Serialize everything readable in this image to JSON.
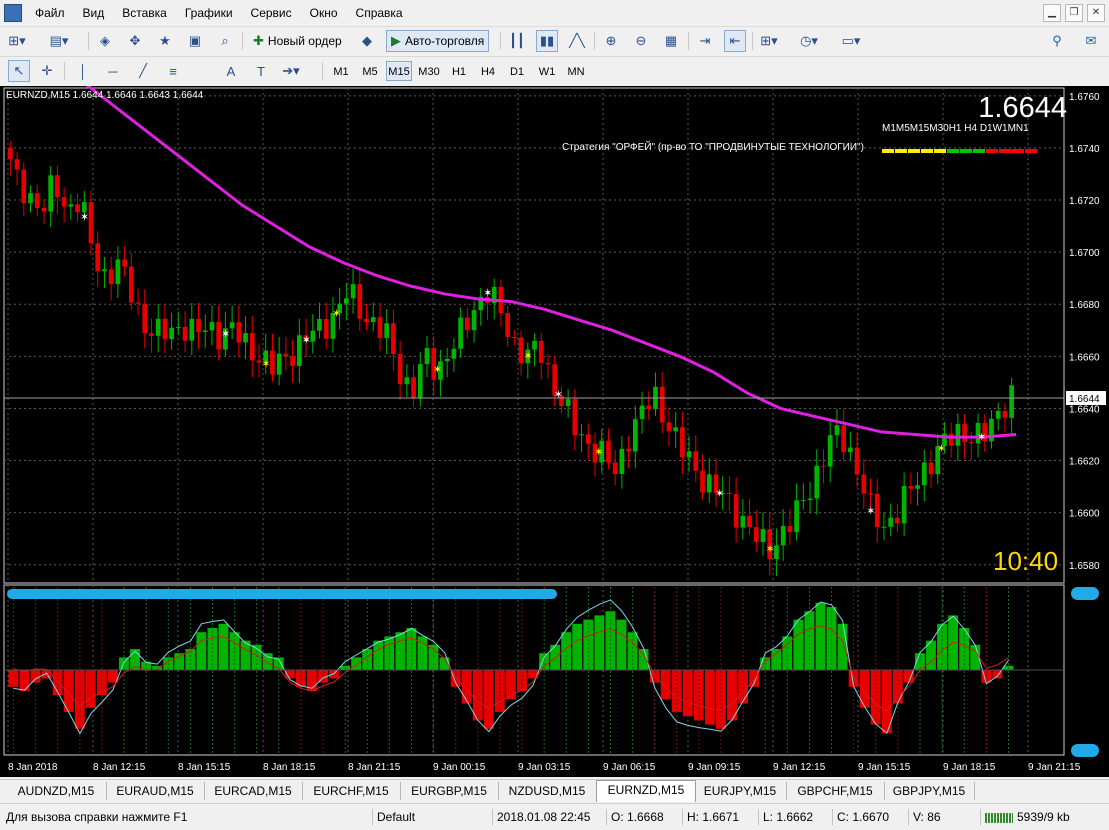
{
  "menu": {
    "items": [
      "Файл",
      "Вид",
      "Вставка",
      "Графики",
      "Сервис",
      "Окно",
      "Справка"
    ]
  },
  "toolbar": {
    "new_order": "Новый ордер",
    "auto_trading": "Авто-торговля",
    "timeframes": [
      "M1",
      "M5",
      "M15",
      "M30",
      "H1",
      "H4",
      "D1",
      "W1",
      "MN"
    ],
    "active_timeframe": "M15"
  },
  "chart": {
    "symbol_label": "EURNZD,M15  1.6644 1.6646 1.6643 1.6644",
    "big_price": "1.6644",
    "tf_strip": "M1M5M15M30H1 H4 D1W1MN1",
    "strategy": "Стратегия \"ОРФЕЙ\" (пр-во ТО \"ПРОДВИНУТЫЕ ТЕХНОЛОГИИ\")",
    "clock": "10:40",
    "current_price_label": "1.6644",
    "colors": {
      "background": "#000000",
      "bull": "#00b400",
      "bear": "#e60000",
      "ma": "#e020e0",
      "grid": "#5a5a5a"
    }
  },
  "chart_data": [
    {
      "type": "candlestick",
      "title": "EURNZD,M15",
      "y_ticks": [
        "1.6760",
        "1.6740",
        "1.6720",
        "1.6700",
        "1.6680",
        "1.6660",
        "1.6640",
        "1.6620",
        "1.6600",
        "1.6580"
      ],
      "x_ticks": [
        "8 Jan 2018",
        "8 Jan 12:15",
        "8 Jan 15:15",
        "8 Jan 18:15",
        "8 Jan 21:15",
        "9 Jan 00:15",
        "9 Jan 03:15",
        "9 Jan 06:15",
        "9 Jan 09:15",
        "9 Jan 12:15",
        "9 Jan 15:15",
        "9 Jan 18:15",
        "9 Jan 21:15"
      ],
      "ylim": [
        1.6573,
        1.6763
      ],
      "current_price": 1.6644,
      "close_path": [
        1.674,
        1.6728,
        1.6722,
        1.6715,
        1.6727,
        1.6716,
        1.672,
        1.67,
        1.669,
        1.6695,
        1.6685,
        1.6672,
        1.6668,
        1.667,
        1.6672,
        1.6668,
        1.6672,
        1.6668,
        1.667,
        1.6665,
        1.666,
        1.6655,
        1.666,
        1.6663,
        1.6668,
        1.6672,
        1.6676,
        1.6685,
        1.6678,
        1.6672,
        1.6668,
        1.6655,
        1.6645,
        1.666,
        1.6655,
        1.6662,
        1.667,
        1.668,
        1.6685,
        1.6676,
        1.6665,
        1.666,
        1.6663,
        1.665,
        1.664,
        1.663,
        1.6626,
        1.6622,
        1.6615,
        1.663,
        1.6638,
        1.6645,
        1.6635,
        1.6625,
        1.6618,
        1.6612,
        1.6608,
        1.6603,
        1.6597,
        1.659,
        1.6586,
        1.6592,
        1.6598,
        1.6608,
        1.6618,
        1.663,
        1.6628,
        1.6615,
        1.66,
        1.6595,
        1.66,
        1.6608,
        1.6616,
        1.6622,
        1.6628,
        1.6632,
        1.6628,
        1.663,
        1.664,
        1.6644
      ],
      "ma_path": [
        1.6768,
        1.6758,
        1.6748,
        1.6738,
        1.6728,
        1.6718,
        1.671,
        1.6702,
        1.6696,
        1.6691,
        1.6687,
        1.6684,
        1.6682,
        1.6681,
        1.6678,
        1.6674,
        1.667,
        1.6665,
        1.666,
        1.6654,
        1.6646,
        1.664,
        1.6637,
        1.6634,
        1.6631,
        1.663,
        1.6629,
        1.6629,
        1.663
      ]
    },
    {
      "type": "histogram",
      "title": "oscillator",
      "values": [
        -4,
        -5,
        -3,
        -2,
        -6,
        -10,
        -14,
        -9,
        -6,
        -3,
        3,
        5,
        2,
        1,
        3,
        4,
        5,
        9,
        10,
        11,
        9,
        7,
        6,
        4,
        3,
        -2,
        -4,
        -5,
        -3,
        -2,
        1,
        3,
        5,
        7,
        8,
        9,
        10,
        8,
        6,
        3,
        -4,
        -8,
        -12,
        -14,
        -10,
        -7,
        -5,
        -2,
        4,
        6,
        9,
        11,
        12,
        13,
        14,
        12,
        9,
        5,
        -3,
        -7,
        -10,
        -11,
        -12,
        -13,
        -14,
        -12,
        -8,
        -4,
        3,
        5,
        8,
        12,
        14,
        16,
        15,
        11,
        -4,
        -9,
        -13,
        -15,
        -8,
        -3,
        4,
        7,
        11,
        13,
        10,
        6,
        -3,
        -2,
        1
      ]
    }
  ],
  "tabs": [
    "AUDNZD,M15",
    "EURAUD,M15",
    "EURCAD,M15",
    "EURCHF,M15",
    "EURGBP,M15",
    "NZDUSD,M15",
    "EURNZD,M15",
    "EURJPY,M15",
    "GBPCHF,M15",
    "GBPJPY,M15"
  ],
  "active_tab": "EURNZD,M15",
  "status": {
    "help": "Для вызова справки нажмите F1",
    "profile": "Default",
    "datetime": "2018.01.08 22:45",
    "open": "O: 1.6668",
    "high": "H: 1.6671",
    "low": "L: 1.6662",
    "close": "C: 1.6670",
    "volume": "V: 86",
    "traffic": "5939/9 kb"
  }
}
